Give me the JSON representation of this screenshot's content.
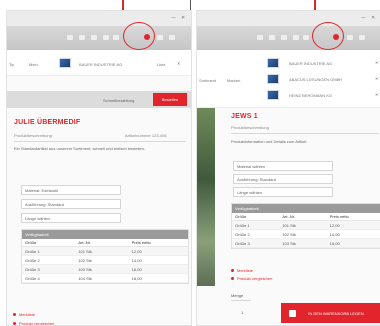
{
  "left": {
    "subnav": [
      "Tip",
      "Mein"
    ],
    "cart_item": "BAUER INDUSTRIE AG",
    "cart_item_side": "Liste",
    "cart_remove": "✕",
    "action_link": "Schnellbestellung",
    "action_button": "Bestellen",
    "title": "JULIE ÜBERMEDIF",
    "subtitle": "Produktbeschreibung",
    "subtitle_right": "Artikelnummer 123-456",
    "description": "Ein Standardartikel aus unserem Sortiment, schnell und einfach bestellen.",
    "selects": [
      "Material: Edelstahl",
      "Ausführung: Standard",
      "Länge wählen"
    ],
    "table_header": "Verfügbarkeit",
    "table_cols": [
      "Größe",
      "Art.-Nr.",
      "Preis netto"
    ],
    "table_rows": [
      [
        "Größe 1",
        "101 Stk",
        "12,00"
      ],
      [
        "Größe 2",
        "102 Stk",
        "14,00"
      ],
      [
        "Größe 3",
        "103 Stk",
        "16,00"
      ],
      [
        "Größe 4",
        "104 Stk",
        "18,00"
      ]
    ],
    "links": [
      "Merkliste",
      "Produkt vergleichen"
    ]
  },
  "right": {
    "subnav": [
      "Sortiment",
      "Marken"
    ],
    "cart_items": [
      "BAUER INDUSTRIE AG",
      "ABACUS LÖSUNGEN GMBH",
      "HEINZ BERGMANN KG"
    ],
    "cart_remove": "✕",
    "title": "JEWS 1",
    "subtitle": "Produktbeschreibung",
    "description": "Produktinformation und Details zum Artikel",
    "selects": [
      "Material wählen",
      "Ausführung: Standard",
      "Länge wählen"
    ],
    "table_header": "Verfügbarkeit",
    "table_cols": [
      "Größe",
      "Art.-Nr.",
      "Preis netto"
    ],
    "table_rows": [
      [
        "Größe 1",
        "101 Stk",
        "12,00"
      ],
      [
        "Größe 2",
        "102 Stk",
        "14,00"
      ],
      [
        "Größe 3",
        "103 Stk",
        "16,00"
      ]
    ],
    "links": [
      "Merkliste",
      "Produkt vergleichen"
    ],
    "qty_label": "Menge",
    "qty_value": "1",
    "cart_button": "IN DEN WARENKORB LEGEN"
  },
  "window": {
    "minimize": "—",
    "close": "✕"
  },
  "colors": {
    "accent": "#e2252d"
  }
}
